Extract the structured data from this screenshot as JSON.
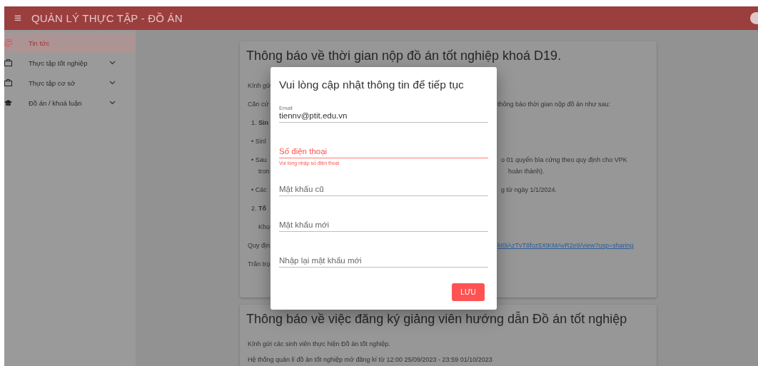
{
  "app_bar": {
    "menu_icon": "≡",
    "title": "QUẢN LÝ THỰC TẬP - ĐỒ ÁN"
  },
  "sidebar": {
    "items": [
      {
        "label": "Tin tức",
        "kind": "news",
        "selected": true,
        "expandable": false
      },
      {
        "label": "Thực tập tốt nghiệp",
        "kind": "briefcase",
        "selected": false,
        "expandable": true
      },
      {
        "label": "Thực tập cơ sở",
        "kind": "briefcase",
        "selected": false,
        "expandable": true
      },
      {
        "label": "Đồ án / khoá luận",
        "kind": "school",
        "selected": false,
        "expandable": true
      }
    ]
  },
  "posts": [
    {
      "title": "Thông báo về thời gian nộp đồ án tốt nghiệp khoá D19.",
      "lines": [
        {
          "kind": "para",
          "left": "Kính gử"
        },
        {
          "kind": "para",
          "left": "Căn cứ",
          "right": "thông báo thời gian nộp đồ án như sau:"
        },
        {
          "kind": "item",
          "left": "1. **Sin**"
        },
        {
          "kind": "item",
          "left": "• Sinl"
        },
        {
          "kind": "item",
          "left": "• Sau",
          "right": "o 01 quyển bìa cứng theo quy định cho VPK"
        },
        {
          "kind": "wrap",
          "left": "tron",
          "right": "hoàn thành)."
        },
        {
          "kind": "item",
          "left": "• Các",
          "right": "g từ ngày 1/1/2024."
        },
        {
          "kind": "item",
          "left": "2. **Tố**"
        },
        {
          "kind": "indent",
          "left": "Kho"
        },
        {
          "kind": "para",
          "left": "Quy địn",
          "link": "kI0iAzTvT8foz5XtKMAvR2e9/view?usp=sharing"
        },
        {
          "kind": "para",
          "left": "Trân trọ"
        }
      ]
    },
    {
      "title": "Thông báo về việc đăng ký giảng viên hướng dẫn Đồ án tốt nghiệp",
      "lines": [
        {
          "kind": "full",
          "left": "Kính gửi các sinh viên thực hiện Đồ án tốt nghiệp."
        },
        {
          "kind": "full",
          "left": "Hệ thống quản lí đồ án tốt nghiệp mở đăng kí từ 12:00 25/09/2023 - 23:59 01/10/2023"
        }
      ]
    }
  ],
  "dialog": {
    "title": "Vui lòng cập nhật thông tin để tiếp tục",
    "fields": [
      {
        "label": "Email",
        "value": "tiennv@ptit.edu.vn",
        "error": false
      },
      {
        "placeholder": "Số điện thoại",
        "error": true,
        "message": "Vui lòng nhập số điện thoại"
      },
      {
        "placeholder": "Mật khẩu cũ",
        "error": false
      },
      {
        "placeholder": "Mật khẩu mới",
        "error": false
      },
      {
        "placeholder": "Nhập lại mật khẩu mới",
        "error": false
      }
    ],
    "button": "LƯU"
  }
}
